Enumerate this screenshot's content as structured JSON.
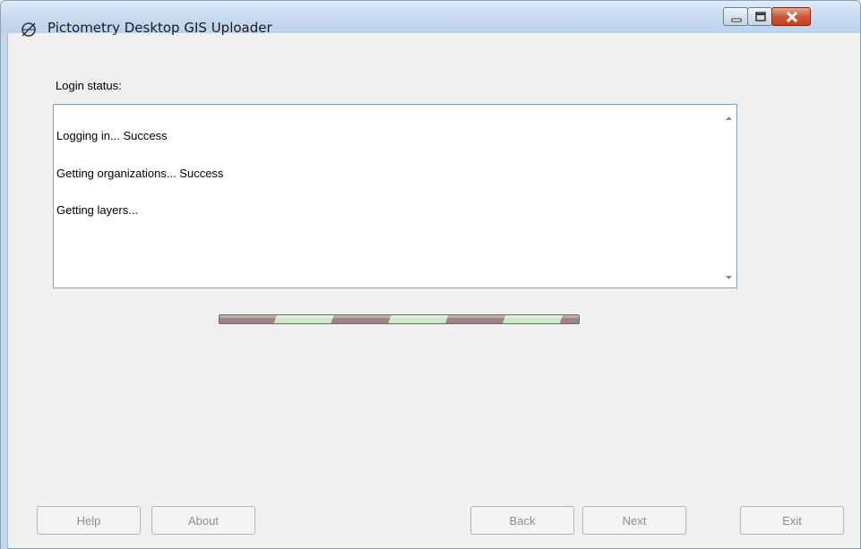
{
  "window": {
    "title": "Pictometry Desktop GIS Uploader",
    "controls": [
      "minimize-icon",
      "maximize-icon",
      "close-icon"
    ]
  },
  "login": {
    "label": "Login status:",
    "lines": [
      "Logging in... Success",
      "Getting organizations... Success",
      "Getting layers..."
    ]
  },
  "progress": {
    "state": "indeterminate",
    "colors": [
      "#9a8380",
      "#cfe6cc"
    ]
  },
  "buttons": {
    "help": "Help",
    "about": "About",
    "back": "Back",
    "next": "Next",
    "exit": "Exit"
  },
  "colors": {
    "titlebar": "#c9dbf0",
    "close_button": "#c94a2e",
    "box_border": "#7ea2c6",
    "disabled_text": "#8d8d8d"
  }
}
